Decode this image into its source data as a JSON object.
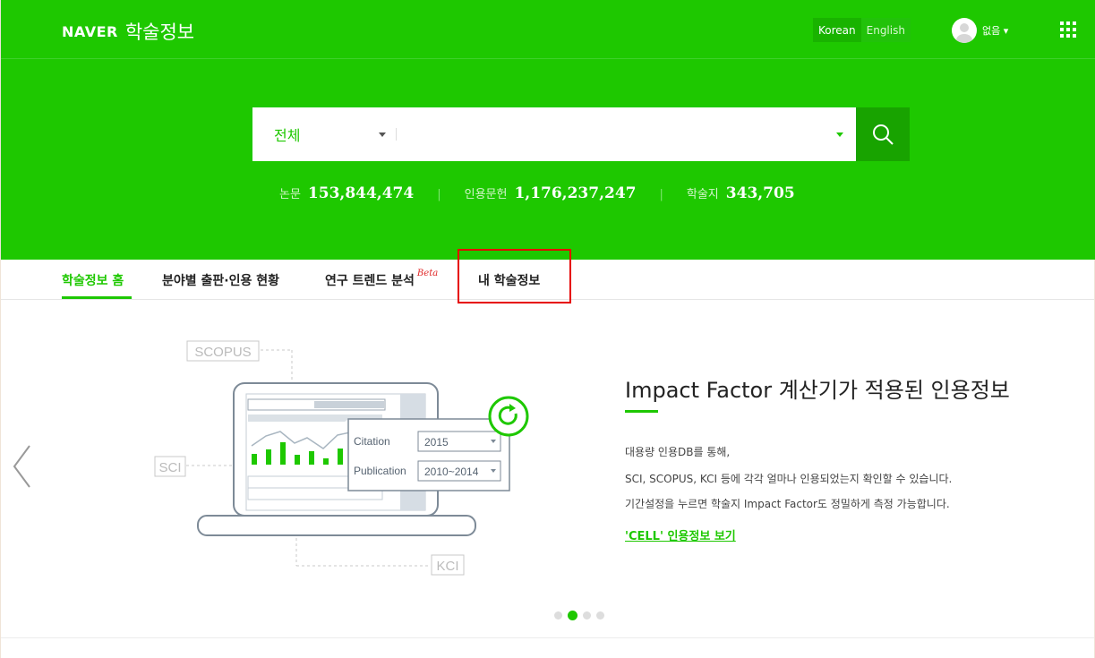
{
  "header": {
    "logo_brand": "NAVER",
    "logo_service": "학술정보",
    "languages": [
      "Korean",
      "English"
    ],
    "active_language": "Korean",
    "user_label": "없음 ▾",
    "accent_color": "#1ec800"
  },
  "search": {
    "scope_value": "전체",
    "input_value": "",
    "button_icon": "search-icon"
  },
  "stats": [
    {
      "label": "논문",
      "value": "153,844,474"
    },
    {
      "label": "인용문헌",
      "value": "1,176,237,247"
    },
    {
      "label": "학술지",
      "value": "343,705"
    }
  ],
  "nav": {
    "items": [
      {
        "label": "학술정보 홈",
        "active": true
      },
      {
        "label": "분야별 출판·인용 현황"
      },
      {
        "label": "연구 트렌드 분석",
        "badge": "Beta"
      },
      {
        "label": "내 학술정보",
        "highlighted": true
      }
    ]
  },
  "banner": {
    "art_labels": {
      "scopus": "SCOPUS",
      "sci": "SCI",
      "kci": "KCI"
    },
    "popup": {
      "citation_label": "Citation",
      "citation_value": "2015",
      "publication_label": "Publication",
      "publication_value": "2010~2014"
    },
    "headline": "Impact Factor 계산기가 적용된 인용정보",
    "description": [
      "대용량 인용DB를 통해,",
      "SCI, SCOPUS, KCI 등에 각각 얼마나 인용되었는지 확인할 수 있습니다.",
      "기간설정을 누르면 학술지 Impact Factor도 정밀하게 측정 가능합니다."
    ],
    "link": "'CELL' 인용정보 보기",
    "slide_count": 4,
    "active_slide": 2
  }
}
